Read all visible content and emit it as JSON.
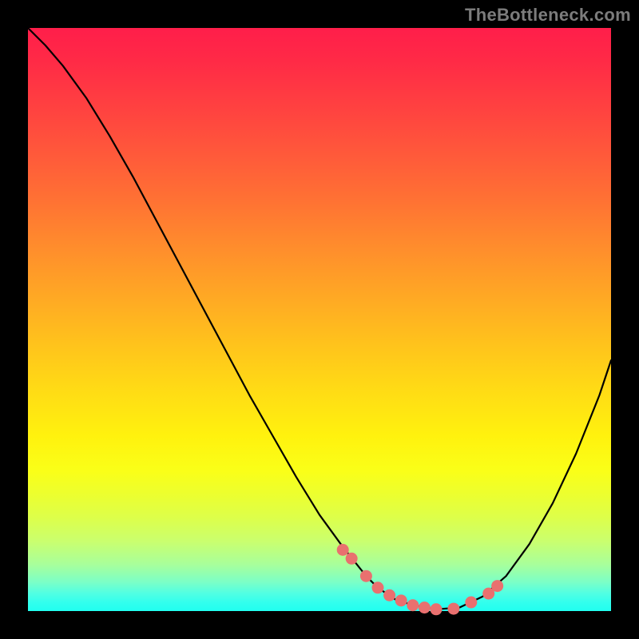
{
  "watermark": "TheBottleneck.com",
  "colors": {
    "marker": "#e9706f",
    "curve": "#000000",
    "frame_bg_top": "#ff1e4a",
    "frame_bg_bottom": "#21fff0"
  },
  "chart_data": {
    "type": "line",
    "title": "",
    "xlabel": "",
    "ylabel": "",
    "xlim": [
      0,
      100
    ],
    "ylim": [
      0,
      100
    ],
    "grid": false,
    "legend": false,
    "series": [
      {
        "name": "bottleneck-curve",
        "x": [
          0,
          3,
          6,
          10,
          14,
          18,
          22,
          26,
          30,
          34,
          38,
          42,
          46,
          50,
          54,
          58,
          60,
          63,
          66,
          70,
          74,
          78,
          82,
          86,
          90,
          94,
          98,
          100
        ],
        "y": [
          100,
          97,
          93.5,
          88,
          81.5,
          74.5,
          67,
          59.5,
          52,
          44.5,
          37,
          30,
          23,
          16.5,
          11,
          6,
          4,
          2,
          1,
          0.3,
          0.6,
          2.5,
          6,
          11.5,
          18.5,
          27,
          37,
          43
        ]
      }
    ],
    "markers": {
      "name": "highlight-points",
      "x": [
        54,
        55.5,
        58,
        60,
        62,
        64,
        66,
        68,
        70,
        73,
        76,
        79,
        80.5
      ],
      "y": [
        10.5,
        9,
        6,
        4,
        2.7,
        1.8,
        1,
        0.6,
        0.3,
        0.4,
        1.5,
        3,
        4.3
      ]
    }
  }
}
